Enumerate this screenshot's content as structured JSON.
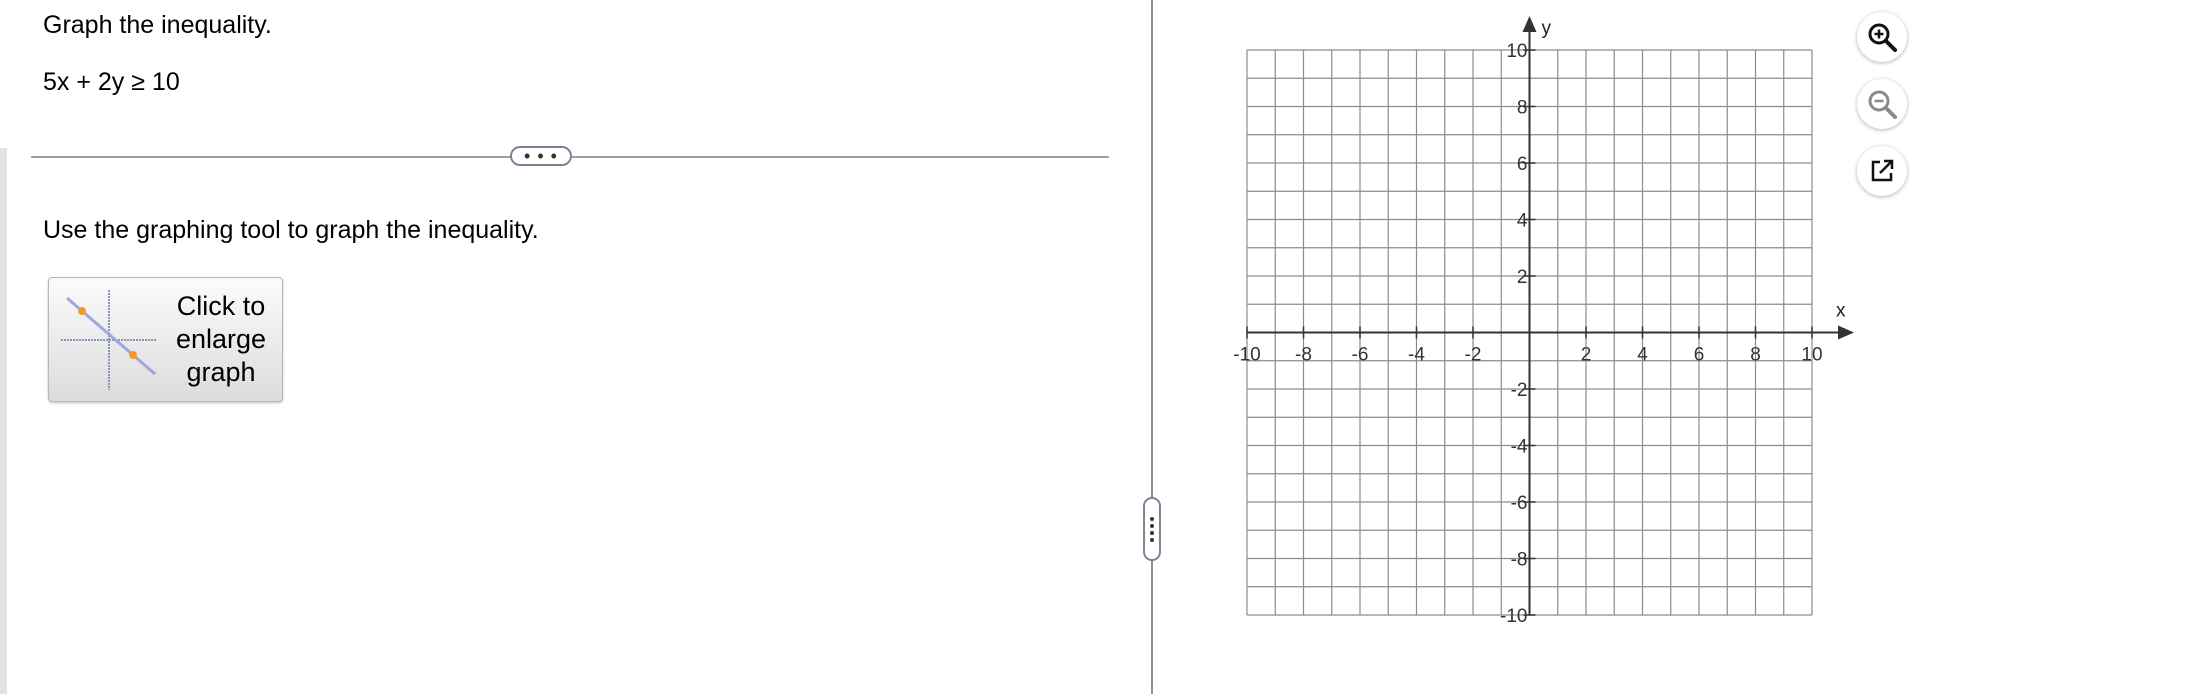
{
  "question": {
    "prompt": "Graph the inequality.",
    "equation": "5x + 2y ≥ 10"
  },
  "divider_handle": "• • •",
  "instruction": "Use the graphing tool to graph the inequality.",
  "enlarge_button": {
    "label": "Click to\nenlarge\ngraph"
  },
  "graph": {
    "x_axis_label": "x",
    "y_axis_label": "y",
    "x_range": [
      -10,
      10
    ],
    "y_range": [
      -10,
      10
    ],
    "grid_step": 1,
    "x_tick_labels": [
      "-10",
      "-8",
      "-6",
      "-4",
      "-2",
      "2",
      "4",
      "6",
      "8",
      "10"
    ],
    "y_tick_labels": [
      "10",
      "8",
      "6",
      "4",
      "2",
      "-2",
      "-4",
      "-6",
      "-8",
      "-10"
    ],
    "grid_color": "#8c8c8c",
    "axis_color": "#333333"
  },
  "tools": {
    "zoom_in": "zoom-in-icon",
    "zoom_out": "zoom-out-icon",
    "popout": "external-link-icon"
  }
}
